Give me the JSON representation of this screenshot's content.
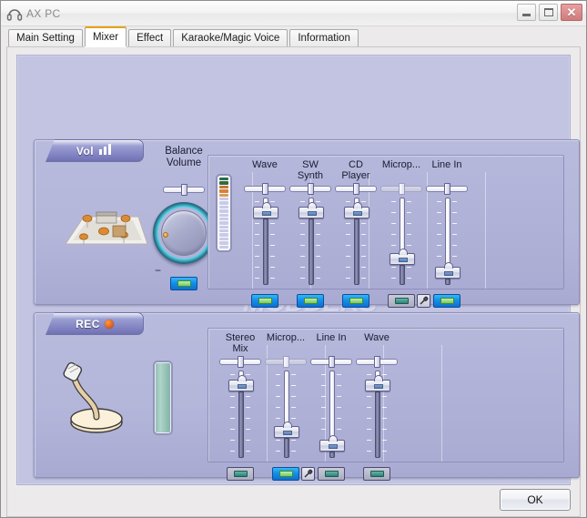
{
  "window": {
    "title": "AX PC",
    "icon": "headphones-icon",
    "buttons": {
      "minimize": "minimize-icon",
      "maximize": "maximize-icon",
      "close": "✕"
    }
  },
  "tabs": [
    {
      "label": "Main Setting",
      "active": false
    },
    {
      "label": "Mixer",
      "active": true
    },
    {
      "label": "Effect",
      "active": false
    },
    {
      "label": "Karaoke/Magic Voice",
      "active": false
    },
    {
      "label": "Information",
      "active": false
    }
  ],
  "playback_panel": {
    "tab_label": "Vol",
    "tab_icon": "volume-bars-icon",
    "balance_label": "Balance",
    "volume_label": "Volume",
    "room_icon": "surround-room-icon",
    "knob": {
      "minus": "−",
      "plus": "+",
      "name": "master-volume-knob"
    },
    "master_mute": {
      "state": "on",
      "label": "master-mute-button"
    },
    "meter": {
      "name": "playback-vu-meter",
      "segments": [
        "#2e6b48",
        "#2e6b48",
        "#c9762c",
        "#d4823a",
        "#dc9a55",
        "#c9cbe8",
        "#c9cbe8",
        "#c9cbe8",
        "#c9cbe8",
        "#c9cbe8",
        "#c9cbe8",
        "#c9cbe8",
        "#c9cbe8",
        "#c9cbe8",
        "#c9cbe8",
        "#c9cbe8",
        "#c9cbe8",
        "#c9cbe8"
      ]
    },
    "channels": [
      {
        "label_line1": "Wave",
        "label_line2": "",
        "balance_dim": false,
        "fader_pct": 88,
        "mute": "on"
      },
      {
        "label_line1": "SW",
        "label_line2": "Synth",
        "balance_dim": false,
        "fader_pct": 88,
        "mute": "on"
      },
      {
        "label_line1": "CD",
        "label_line2": "Player",
        "balance_dim": false,
        "fader_pct": 88,
        "mute": "on"
      },
      {
        "label_line1": "Microp...",
        "label_line2": "",
        "balance_dim": true,
        "fader_pct": 26,
        "mute": "off",
        "tool": "microphone-icon"
      },
      {
        "label_line1": "Line In",
        "label_line2": "",
        "balance_dim": false,
        "fader_pct": 8,
        "mute": "on"
      }
    ]
  },
  "record_panel": {
    "tab_label": "REC",
    "tab_icon": "record-dot-icon",
    "mic_icon": "desk-microphone-icon",
    "level_bar_name": "record-level-bar",
    "channels": [
      {
        "label_line1": "Stereo",
        "label_line2": "Mix",
        "balance_dim": false,
        "fader_pct": 88,
        "mute": "off"
      },
      {
        "label_line1": "Microp...",
        "label_line2": "",
        "balance_dim": true,
        "fader_pct": 26,
        "mute": "on",
        "tool": "microphone-icon"
      },
      {
        "label_line1": "Line In",
        "label_line2": "",
        "balance_dim": false,
        "fader_pct": 8,
        "mute": "off"
      },
      {
        "label_line1": "Wave",
        "label_line2": "",
        "balance_dim": false,
        "fader_pct": 88,
        "mute": "off"
      }
    ]
  },
  "footer": {
    "ok_label": "OK"
  },
  "watermark": {
    "line1": "MODDERS",
    "line2": ".com"
  },
  "colors": {
    "panel_bg": "#b4b6da",
    "stage_bg": "#c3c4e2",
    "accent_tab": "#e8a317",
    "mute_on": "#1390e8",
    "led_on": "#76c85f",
    "led_off": "#2e8176"
  }
}
